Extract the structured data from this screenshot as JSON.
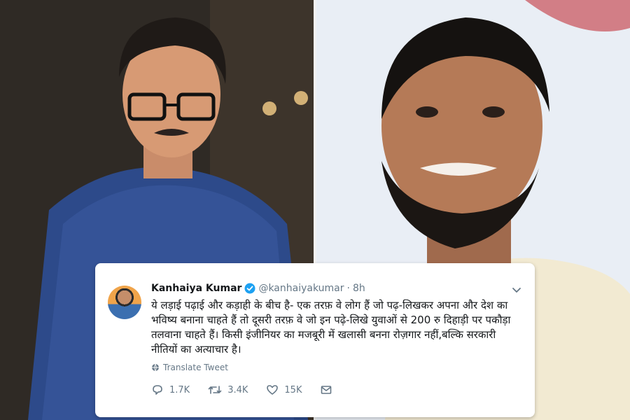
{
  "tweet": {
    "author": "Kanhaiya Kumar",
    "handle": "@kanhaiyakumar",
    "separator": "·",
    "time": "8h",
    "text": "ये लड़ाई पढ़ाई और कड़ाही के बीच है- एक तरफ़ वे लोग हैं जो पढ़-लिखकर अपना और देश का भविष्य बनाना चाहते हैं तो दूसरी तरफ़ वे जो इन पढ़े-लिखे युवाओं से 200 रु दिहाड़ी पर पकौड़ा तलवाना चाहते हैं। किसी इंजीनियर का मजबूरी में खलासी बनना रोज़गार नहीं,बल्कि सरकारी नीतियों का अत्याचार है।",
    "translate_label": "Translate Tweet",
    "replies": "1.7K",
    "retweets": "3.4K",
    "likes": "15K"
  },
  "icons": {
    "verified": "verified-badge-icon",
    "chevron": "chevron-down-icon",
    "globe": "globe-icon",
    "reply": "reply-icon",
    "retweet": "retweet-icon",
    "like": "heart-icon",
    "dm": "envelope-icon"
  },
  "colors": {
    "verified_blue": "#1da1f2",
    "text": "#14171a",
    "secondary": "#657786"
  }
}
